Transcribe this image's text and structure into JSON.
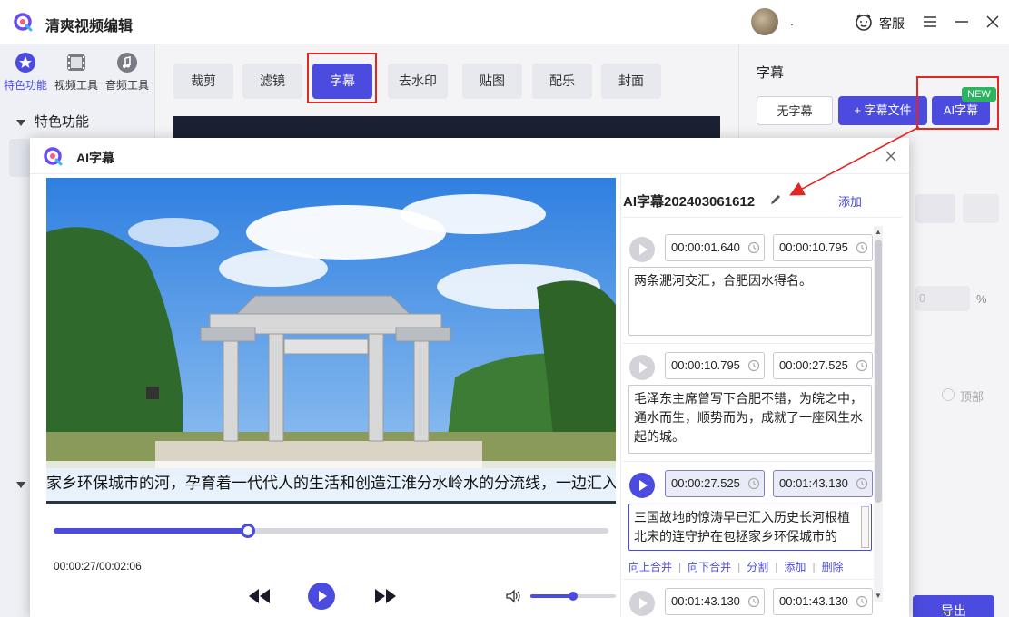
{
  "app": {
    "title": "清爽视频编辑",
    "user_name": ".",
    "service_label": "客服"
  },
  "sidebar": {
    "tabs": [
      {
        "label": "特色功能",
        "active": true
      },
      {
        "label": "视频工具",
        "active": false
      },
      {
        "label": "音频工具",
        "active": false
      }
    ],
    "tree_header": "特色功能"
  },
  "tool_tabs": [
    {
      "label": "裁剪",
      "active": false
    },
    {
      "label": "滤镜",
      "active": false
    },
    {
      "label": "字幕",
      "active": true
    },
    {
      "label": "去水印",
      "active": false
    },
    {
      "label": "贴图",
      "active": false
    },
    {
      "label": "配乐",
      "active": false
    },
    {
      "label": "封面",
      "active": false
    }
  ],
  "right_panel": {
    "title": "字幕",
    "no_subtitle_button": "无字幕",
    "subtitle_file_button": "+ 字幕文件",
    "ai_subtitle_button": "AI字幕",
    "new_badge": "NEW",
    "ghost_value": "0",
    "ghost_unit": "%",
    "ghost_option": "顶部",
    "export_button": "导出"
  },
  "dialog": {
    "title": "AI字幕",
    "video": {
      "subtitle_overlay": "家乡环保城市的河，孕育着一代代人的生活和创造江淮分水岭水的分流线，一边汇入淮",
      "current_time": "00:00:27",
      "total_time": "00:02:06",
      "time_display": "00:00:27/00:02:06",
      "progress_fraction": 0.35,
      "volume_fraction": 0.5
    },
    "list": {
      "title": "AI字幕202403061612",
      "add_label": "添加",
      "segments": [
        {
          "start": "00:00:01.640",
          "end": "00:00:10.795",
          "text": "两条淝河交汇，合肥因水得名。",
          "active": false
        },
        {
          "start": "00:00:10.795",
          "end": "00:00:27.525",
          "text": "毛泽东主席曾写下合肥不错，为皖之中，通水而生，顺势而为，成就了一座风生水起的城。",
          "active": false
        },
        {
          "start": "00:00:27.525",
          "end": "00:01:43.130",
          "text": "三国故地的惊涛早已汇入历史长河根植北宋的连守护在包拯家乡环保城市的",
          "active": true
        },
        {
          "start": "00:01:43.130",
          "end": "00:01:43.130",
          "text": "",
          "active": false
        }
      ],
      "actions": {
        "merge_up": "向上合并",
        "merge_down": "向下合并",
        "split": "分割",
        "add": "添加",
        "delete": "删除"
      }
    }
  },
  "colors": {
    "accent": "#4b4be0",
    "annotation": "#e3261f",
    "badge": "#2ab45e"
  }
}
